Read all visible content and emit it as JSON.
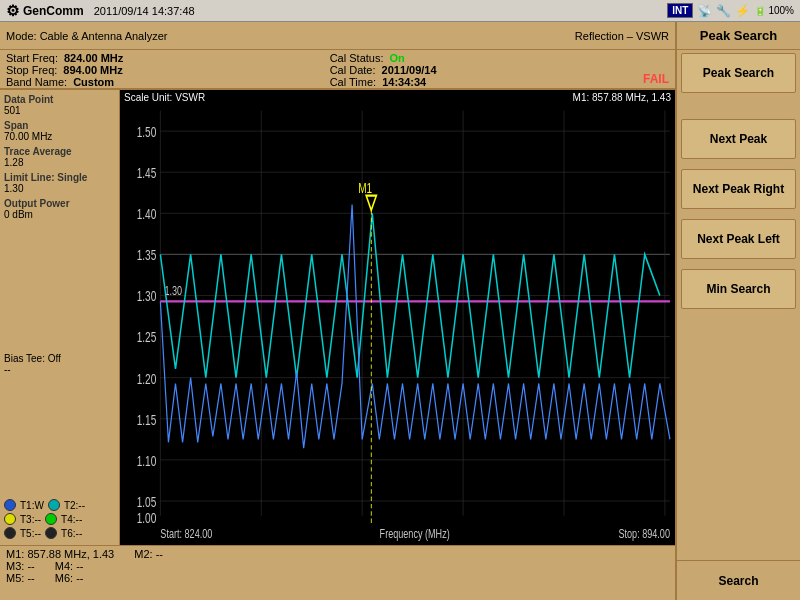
{
  "topBar": {
    "logo": "GenComm",
    "datetime": "2011/09/14  14:37:48",
    "intBadge": "INT",
    "batteryText": "100%"
  },
  "header": {
    "mode": "Mode: Cable & Antenna Analyzer",
    "measurement": "Reflection – VSWR"
  },
  "info": {
    "startFreq": {
      "label": "Start Freq:",
      "value": "824.00 MHz"
    },
    "stopFreq": {
      "label": "Stop Freq:",
      "value": "894.00 MHz"
    },
    "bandName": {
      "label": "Band Name:",
      "value": "Custom"
    },
    "calStatus": {
      "label": "Cal Status:",
      "value": "On"
    },
    "calDate": {
      "label": "Cal Date:",
      "value": "2011/09/14"
    },
    "calTime": {
      "label": "Cal Time:",
      "value": "14:34:34"
    },
    "fail": "FAIL"
  },
  "chart": {
    "scaleUnit": "Scale Unit: VSWR",
    "markerLabel": "M1: 857.88 MHz, 1.43",
    "yLabels": [
      "1.50",
      "1.45",
      "1.40",
      "1.35",
      "1.30",
      "1.25",
      "1.20",
      "1.15",
      "1.10",
      "1.05",
      "1.00"
    ],
    "xStart": "Start: 824.00",
    "xCenter": "Frequency (MHz)",
    "xStop": "Stop: 894.00"
  },
  "chartParams": {
    "dataPointLabel": "Data Point",
    "dataPointValue": "501",
    "spanLabel": "Span",
    "spanValue": "70.00 MHz",
    "traceAvgLabel": "Trace Average",
    "traceAvgValue": "1.28",
    "limitLineLabel": "Limit Line: Single",
    "limitLineValue": "1.30",
    "outputPowerLabel": "Output Power",
    "outputPowerValue": "0 dBm",
    "biasTeeLabel": "Bias Tee: Off",
    "biasTeeValue": "--"
  },
  "traces": [
    {
      "label": "T1:W",
      "color": "#2255cc"
    },
    {
      "label": "T2:--",
      "color": "#00aaaa"
    },
    {
      "label": "T3:--",
      "color": "#dddd00"
    },
    {
      "label": "T4:--",
      "color": "#00cc00"
    },
    {
      "label": "T5:--",
      "color": "#333333"
    },
    {
      "label": "T6:--",
      "color": "#333333"
    }
  ],
  "markers": {
    "m1": "M1: 857.88 MHz, 1.43",
    "m2": "M2: --",
    "m3": "M3: --",
    "m4": "M4: --",
    "m5": "M5: --",
    "m6": "M6: --"
  },
  "rightPanel": {
    "title": "Peak Search",
    "buttons": [
      {
        "id": "peak-search-btn",
        "label": "Peak Search"
      },
      {
        "id": "next-peak-btn",
        "label": "Next Peak"
      },
      {
        "id": "next-peak-right-btn",
        "label": "Next Peak Right"
      },
      {
        "id": "next-peak-left-btn",
        "label": "Next Peak Left"
      },
      {
        "id": "min-search-btn",
        "label": "Min Search"
      }
    ],
    "bottomLabel": "Search"
  }
}
